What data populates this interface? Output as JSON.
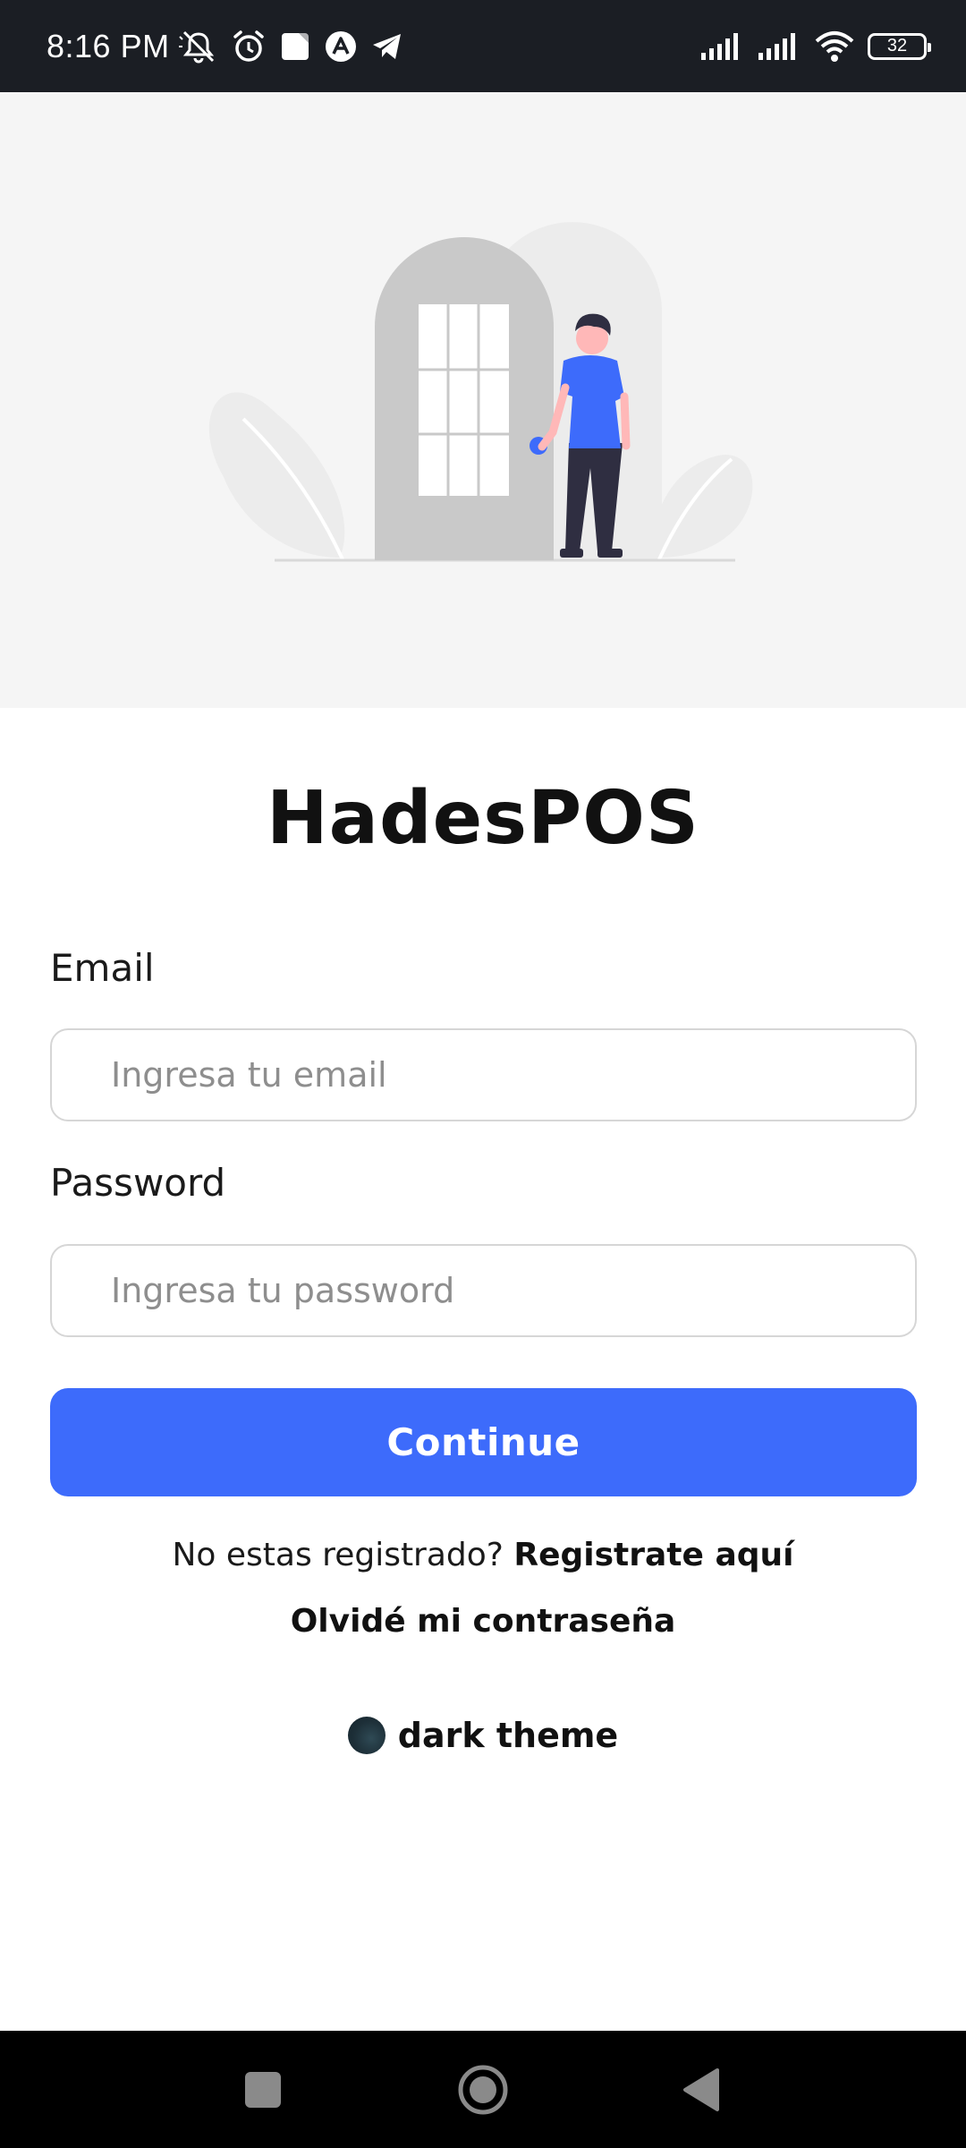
{
  "status_bar": {
    "time": "8:16 PM",
    "left_icons": [
      "mute-icon",
      "alarm-icon",
      "square-app-icon",
      "app-a-icon",
      "telegram-icon"
    ],
    "right_icons": [
      "signal-icon",
      "signal-icon",
      "wifi-icon",
      "battery-icon"
    ],
    "battery_level": "32"
  },
  "hero": {
    "illustration": "person-at-door-illustration"
  },
  "login": {
    "app_title": "HadesPOS",
    "email_label": "Email",
    "email_placeholder": "Ingresa tu email",
    "password_label": "Password",
    "password_placeholder": "Ingresa tu password",
    "continue_label": "Continue",
    "register_prompt": "No estas registrado?",
    "register_link": "Registrate aquí",
    "forgot_link": "Olvidé mi contraseña",
    "theme_toggle_label": "dark theme"
  },
  "nav_bar": {
    "buttons": [
      "recents-button",
      "home-button",
      "back-button"
    ]
  },
  "colors": {
    "primary": "#3d6bfb",
    "status_bar_bg": "#1b1e24",
    "hero_bg": "#f5f5f5",
    "nav_bar_bg": "#000000"
  }
}
